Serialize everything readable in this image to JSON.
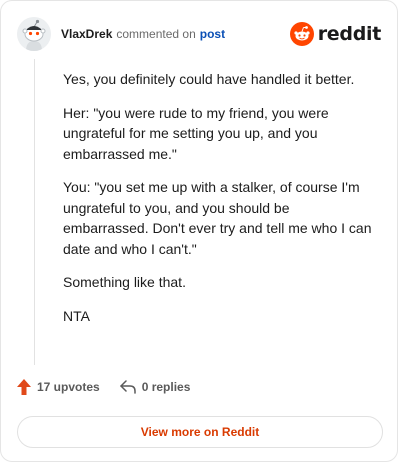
{
  "header": {
    "username": "VlaxDrek",
    "action": "commented on",
    "post_link": "post",
    "brand": "reddit"
  },
  "comment": {
    "paragraphs": [
      "Yes, you definitely could have handled it better.",
      "Her: \"you were rude to my friend, you were ungrateful for me setting you up, and you embarrassed me.\"",
      "You: \"you set me up with a stalker, of course I'm ungrateful to you, and you should be embarrassed. Don't ever try and tell me who I can date and who I can't.\"",
      "Something like that.",
      "NTA"
    ]
  },
  "footer": {
    "upvotes": "17 upvotes",
    "replies": "0 replies"
  },
  "cta": {
    "label": "View more on Reddit"
  },
  "icons": {
    "avatar": "snoo-avatar-icon",
    "brand": "reddit-logo-icon",
    "upvote": "upvote-arrow-icon",
    "reply": "reply-arrow-icon"
  },
  "colors": {
    "brand_orange": "#ff4500",
    "upvote": "#e0491a",
    "link": "#0a4fb5",
    "cta_text": "#d93a00"
  }
}
